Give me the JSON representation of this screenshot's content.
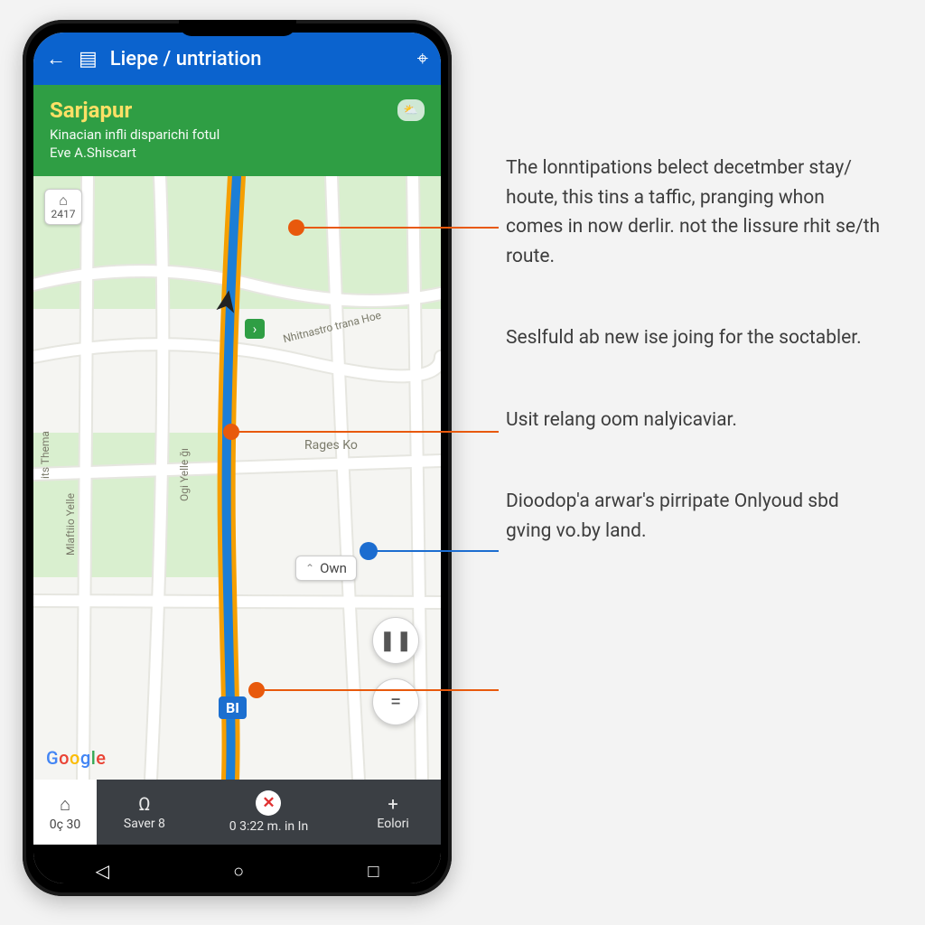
{
  "topbar": {
    "back_icon": "←",
    "layers_icon": "▤",
    "title": "Liepe / untriation",
    "gps_icon": "⌖"
  },
  "dest": {
    "title": "Sarjapur",
    "line1": "Kinacian infli disparichi fotul",
    "line2": "Eve A.Shiscart",
    "badge": "⛅"
  },
  "map": {
    "home_badge_num": "2417",
    "own_label": "Own",
    "bl_label": "BI",
    "poi_rages": "Rages Ko",
    "poi_nh": "Nhitnastro trana Hoe",
    "poi_left1": "its Thema",
    "poi_left2": "Mlaftiio Yelle",
    "poi_ogi": "Ogi Yelle ğı"
  },
  "fabs": {
    "pause": "❚❚",
    "more": "="
  },
  "google": [
    "G",
    "o",
    "o",
    "g",
    "l",
    "e"
  ],
  "strip": {
    "cell1_icon": "⌂",
    "cell1_label": "0ç 30",
    "cell2_icon": "Ω",
    "cell2_label": "Saver 8",
    "center_label": "0 3:22 m. in In",
    "cell4_icon": "+",
    "cell4_label": "Eolori"
  },
  "nav": {
    "back": "◁",
    "home": "○",
    "recent": "□"
  },
  "callouts": [
    "The lonntipations belect decetmber  stay/ houte, this tins a taffic, pranging whon comes in now derlir. not the lissure rhit se/th route.",
    "Seslfuld ab new ise joing for the soctabler.",
    "Usit relang oom nalyicaviar.",
    "Dioodop'a arwar's pirripate Onlyoud sbd gving vo.by land."
  ]
}
